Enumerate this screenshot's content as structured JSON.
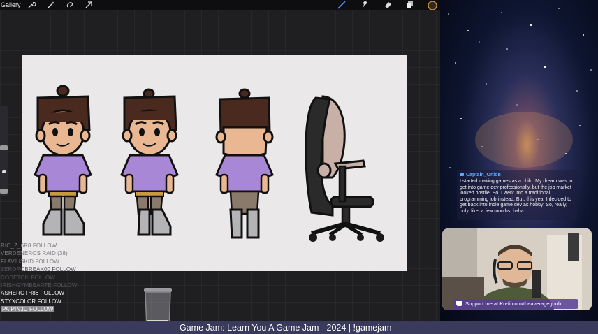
{
  "app": {
    "gallery_label": "Gallery",
    "toolbar_left": [
      "wrench-icon",
      "magic-wand-icon",
      "selection-icon",
      "transform-arrow-icon"
    ],
    "toolbar_right": [
      "brush-icon",
      "smudge-icon",
      "eraser-icon",
      "layers-icon",
      "color-swatch-icon"
    ]
  },
  "stream_chat": {
    "events": [
      {
        "text": "RIO_Z_6R8  FOLLOW",
        "style": "faded"
      },
      {
        "text": "VERDENEROS  RAID (38)",
        "style": "faded"
      },
      {
        "text": "FLAVIUSKID  FOLLOW",
        "style": "faded"
      },
      {
        "text": "ZEROPOBREAK00  FOLLOW",
        "style": "dim"
      },
      {
        "text": "CODETOIL  FOLLOW",
        "style": "dim"
      },
      {
        "text": "IRISHGYMBEARTE  FOLLOW",
        "style": "dim"
      },
      {
        "text": "ASHEROTH86  FOLLOW",
        "style": "bright"
      },
      {
        "text": "STYXCOLOR  FOLLOW",
        "style": "bright"
      },
      {
        "text": "PAIPIN3D  FOLLOW",
        "style": "hl"
      }
    ]
  },
  "chat_message": {
    "author": "Captain_Onion",
    "text": "I started making games as a child. My dream was to get into game dev professionally, but the job market looked hostile. So, I went into a traditional programming job instead. But, this year I decided to get back into indie game dev as hobby! So, really, only, like, a few months, haha."
  },
  "kofi": {
    "text": "Support me at Ko-fi.com/theaveragegoob"
  },
  "ticker": {
    "text": "Game Jam: Learn You A Game Jam - 2024 | !gamejam"
  },
  "colors": {
    "hair": "#4a2a1e",
    "skin": "#e9b893",
    "shirt": "#a887d6",
    "pants": "#8a7a6c",
    "shoes": "#b4b4b6",
    "chair": "#2a2a2a",
    "chair_back": "#c9b0a6",
    "ticker_bar": "#3a3a5c"
  }
}
